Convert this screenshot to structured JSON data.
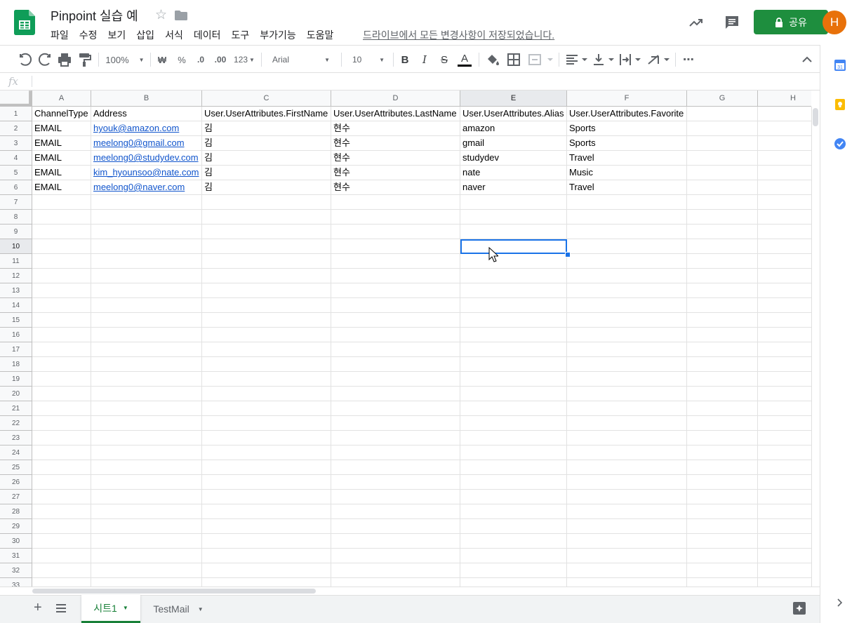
{
  "header": {
    "doc_title": "Pinpoint 실습 예",
    "menu": [
      "파일",
      "수정",
      "보기",
      "삽입",
      "서식",
      "데이터",
      "도구",
      "부가기능",
      "도움말"
    ],
    "save_status": "드라이브에서 모든 변경사항이 저장되었습니다.",
    "share_label": "공유",
    "avatar_letter": "H"
  },
  "toolbar": {
    "zoom": "100%",
    "currency": "₩",
    "percent": "%",
    "decimal_decrease": ".0",
    "decimal_increase": ".00",
    "format_more": "123",
    "font": "Arial",
    "font_size": "10",
    "bold": "B",
    "italic": "I",
    "strike": "S",
    "text_color": "A",
    "more": "⋯"
  },
  "formula": {
    "fx": "fx",
    "value": ""
  },
  "grid": {
    "columns": [
      "A",
      "B",
      "C",
      "D",
      "E",
      "F",
      "G",
      "H"
    ],
    "row_numbers": [
      "1",
      "2",
      "3",
      "4",
      "5",
      "6",
      "7",
      "8",
      "9",
      "10",
      "11",
      "12",
      "13",
      "14",
      "15",
      "16",
      "17",
      "18",
      "19",
      "20",
      "21",
      "22",
      "23",
      "24",
      "25",
      "26",
      "27",
      "28",
      "29",
      "30",
      "31",
      "32",
      "33"
    ],
    "rows": [
      [
        "ChannelType",
        "Address",
        "User.UserAttributes.FirstName",
        "User.UserAttributes.LastName",
        "User.UserAttributes.Alias",
        "User.UserAttributes.Favorite",
        "",
        ""
      ],
      [
        "EMAIL",
        "hyouk@amazon.com",
        "김",
        "현수",
        "amazon",
        "Sports",
        "",
        ""
      ],
      [
        "EMAIL",
        "meelong0@gmail.com",
        "김",
        "현수",
        "gmail",
        "Sports",
        "",
        ""
      ],
      [
        "EMAIL",
        "meelong0@studydev.com",
        "김",
        "현수",
        "studydev",
        "Travel",
        "",
        ""
      ],
      [
        "EMAIL",
        "kim_hyounsoo@nate.com",
        "김",
        "현수",
        "nate",
        "Music",
        "",
        ""
      ],
      [
        "EMAIL",
        "meelong0@naver.com",
        "김",
        "현수",
        "naver",
        "Travel",
        "",
        ""
      ]
    ],
    "selected_cell": "E10"
  },
  "sheets": {
    "tabs": [
      "시트1",
      "TestMail"
    ],
    "active": "시트1"
  },
  "colors": {
    "share_green": "#1e8e3e",
    "avatar_orange": "#e8710a",
    "selection_blue": "#1a73e8",
    "link_blue": "#1155cc",
    "active_tab_green": "#188038"
  },
  "icons": [
    "sheets-logo",
    "star-icon",
    "folder-icon",
    "trend-icon",
    "comment-icon",
    "lock-icon",
    "undo-icon",
    "redo-icon",
    "print-icon",
    "paint-format-icon",
    "fill-color-icon",
    "borders-icon",
    "merge-icon",
    "align-icon",
    "valign-icon",
    "wrap-icon",
    "rotate-icon",
    "collapse-icon",
    "calendar-icon",
    "keep-icon",
    "tasks-icon",
    "explore-icon",
    "sheet-list-icon",
    "cursor-icon"
  ]
}
